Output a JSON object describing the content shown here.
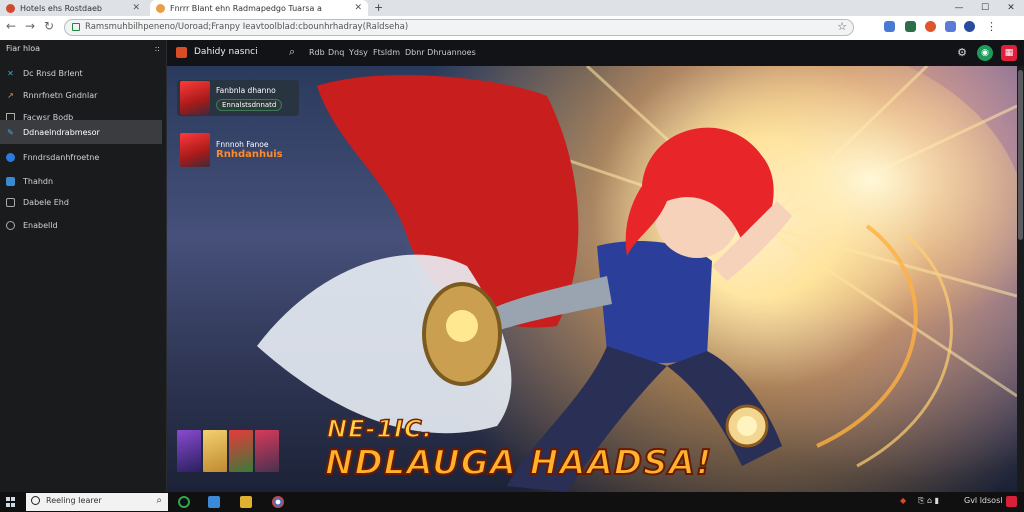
{
  "browser": {
    "tabs": [
      {
        "title": "Hotels ehs Rostdaeb",
        "active": false
      },
      {
        "title": "Fnrrr Blant ehn Radmapedgo Tuarsa a",
        "active": true
      }
    ],
    "new_tab_symbol": "+",
    "window_controls": {
      "minimize": "—",
      "maximize": "☐",
      "close": "✕"
    },
    "url": "Ramsmuhbilhpeneno/Uoroad;Franpy Ieavtoolblad:cbounhrhadray(Raldseha)"
  },
  "sidebar": {
    "header": "Fiar hloa",
    "header_action": "::",
    "items": [
      {
        "label": "Dc Rnsd Brlent",
        "active": false
      },
      {
        "label": "Rnnrfnetn Gndnlar",
        "active": false
      },
      {
        "label": "Facwsr Bodb",
        "active": false
      },
      {
        "label": "Ddnaelndrabmesor",
        "active": true
      },
      {
        "label": "Fnndrsdanhfroetne",
        "active": false
      },
      {
        "label": "Thahdn",
        "active": false
      },
      {
        "label": "Dabele Ehd",
        "active": false
      },
      {
        "label": "Enabelld",
        "active": false
      }
    ]
  },
  "page": {
    "title": "Dahidy nasnci",
    "nav": [
      "Rdb",
      "Dnq",
      "Ydsy",
      "Ftsldm",
      "Dbnr Dhruannoes"
    ],
    "cards": [
      {
        "title": "Fanbnla dhanno",
        "pill": "Ennalstsdnnatd"
      },
      {
        "title": "Fnnnoh Fanoe",
        "subtitle": "Rnhdanhuis"
      }
    ],
    "headline_top": "NE-1IC.",
    "headline_main": "NDLAUGA HAADSA!"
  },
  "taskbar": {
    "search_placeholder": "Reeling Iearer",
    "tray_text": "Gvl ldsosl"
  },
  "colors": {
    "accent_orange": "#d74e26",
    "sidebar_bg": "#1a1b1d",
    "active_item_bg": "#3a3c40",
    "pill_border": "#3c7a5c",
    "headline_fill": "#ffb22c",
    "headline_stroke": "#6a1a00"
  }
}
